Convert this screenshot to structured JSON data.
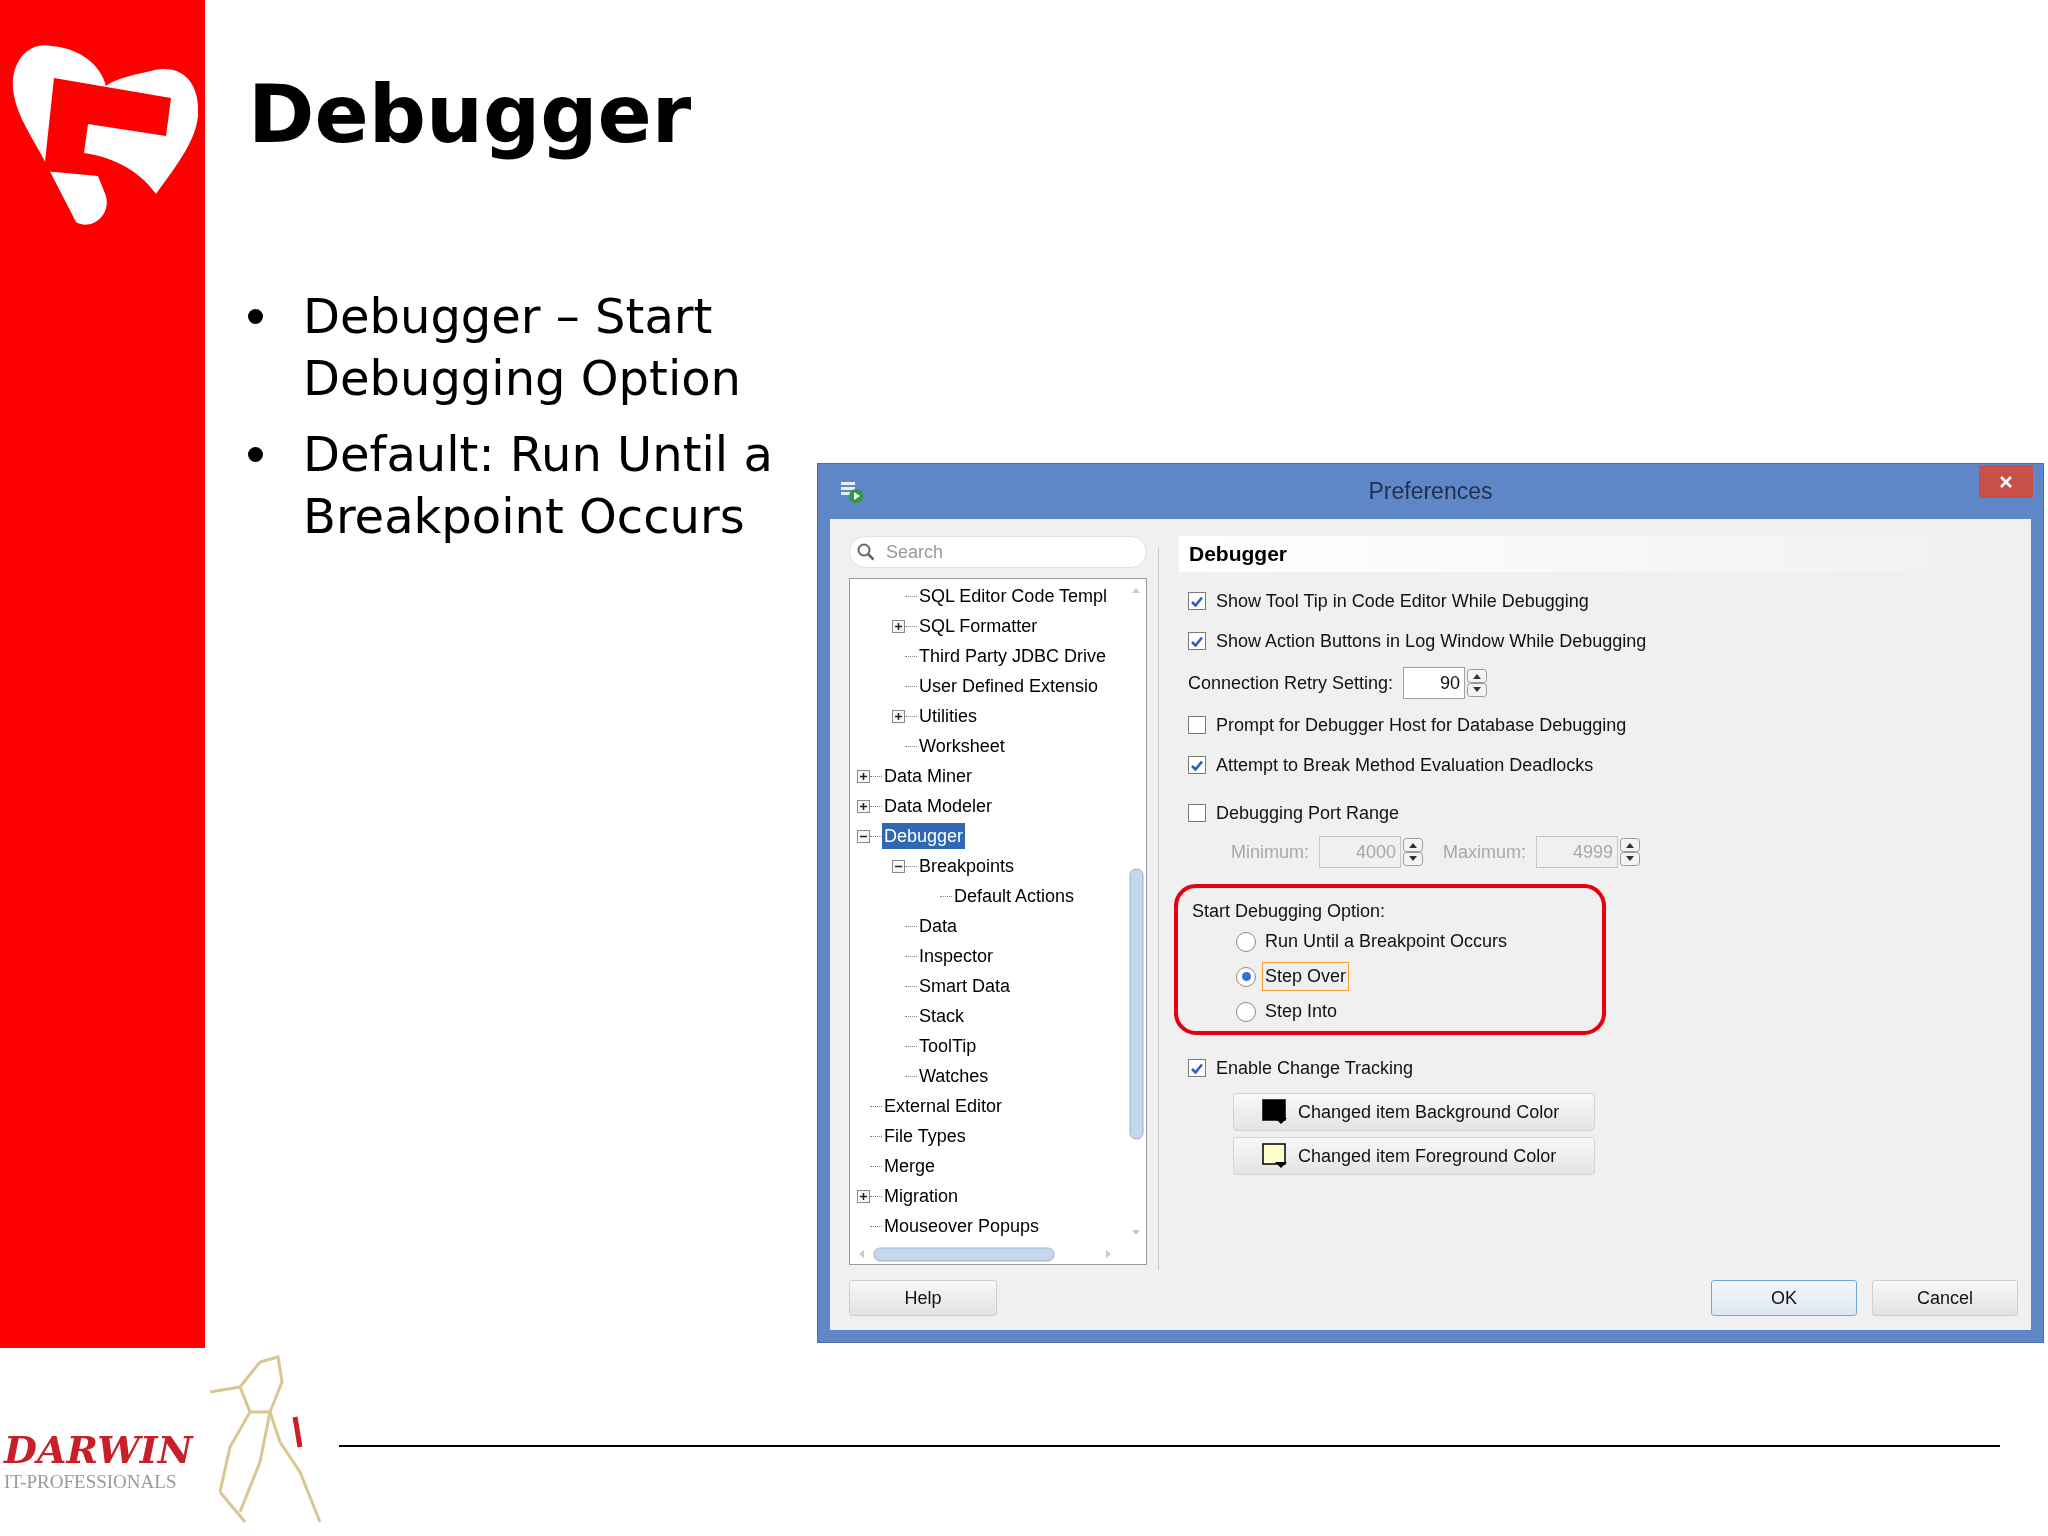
{
  "slide": {
    "title": "Debugger",
    "bullets": [
      "Debugger – Start Debugging Option",
      "Default: Run Until a Breakpoint Occurs"
    ],
    "footer_logo": {
      "name": "DARWIN",
      "tagline": "IT-PROFESSIONALS"
    }
  },
  "dialog": {
    "title": "Preferences",
    "search": {
      "placeholder": "Search"
    },
    "tree": {
      "continued_children": [
        {
          "label": "SQL Editor Code Templ",
          "selected": false
        },
        {
          "label": "SQL Formatter",
          "selected": false,
          "expanded": false
        },
        {
          "label": "Third Party JDBC Drive",
          "selected": false
        },
        {
          "label": "User Defined Extensio",
          "selected": false
        },
        {
          "label": "Utilities",
          "selected": false,
          "expanded": false
        },
        {
          "label": "Worksheet",
          "selected": false
        }
      ],
      "items": [
        {
          "label": "Data Miner",
          "selected": false,
          "expanded": false
        },
        {
          "label": "Data Modeler",
          "selected": false,
          "expanded": false
        },
        {
          "label": "Debugger",
          "selected": true,
          "expanded": true,
          "children": [
            {
              "label": "Breakpoints",
              "selected": false,
              "expanded": true,
              "children": [
                {
                  "label": "Default Actions",
                  "selected": false
                }
              ]
            },
            {
              "label": "Data",
              "selected": false
            },
            {
              "label": "Inspector",
              "selected": false
            },
            {
              "label": "Smart Data",
              "selected": false
            },
            {
              "label": "Stack",
              "selected": false
            },
            {
              "label": "ToolTip",
              "selected": false
            },
            {
              "label": "Watches",
              "selected": false
            }
          ]
        },
        {
          "label": "External Editor",
          "selected": false
        },
        {
          "label": "File Types",
          "selected": false
        },
        {
          "label": "Merge",
          "selected": false
        },
        {
          "label": "Migration",
          "selected": false,
          "expanded": false
        },
        {
          "label": "Mouseover Popups",
          "selected": false
        }
      ]
    },
    "panel_title": "Debugger",
    "options": [
      {
        "kind": "checkbox",
        "label": "Show Tool Tip in Code Editor While Debugging",
        "checked": true
      },
      {
        "kind": "checkbox",
        "label": "Show Action Buttons in Log Window While Debugging",
        "checked": true
      },
      {
        "kind": "spinner",
        "label": "Connection Retry Setting:",
        "value": "90"
      },
      {
        "kind": "checkbox",
        "label": "Prompt for Debugger Host for Database Debugging",
        "checked": false
      },
      {
        "kind": "checkbox",
        "label": "Attempt to Break Method Evaluation Deadlocks",
        "checked": true
      },
      {
        "kind": "checkbox",
        "label": "Debugging Port Range",
        "checked": false
      },
      {
        "kind": "range",
        "disabled": true,
        "min_label": "Minimum:",
        "min_value": "4000",
        "max_label": "Maximum:",
        "max_value": "4999"
      },
      {
        "kind": "radio_group",
        "label": "Start Debugging Option:",
        "highlighted": true,
        "options": [
          {
            "label": "Run Until a Breakpoint Occurs",
            "selected": false,
            "focused": false
          },
          {
            "label": "Step Over",
            "selected": true,
            "focused": true
          },
          {
            "label": "Step Into",
            "selected": false,
            "focused": false
          }
        ]
      },
      {
        "kind": "checkbox",
        "label": "Enable Change Tracking",
        "checked": true
      },
      {
        "kind": "color_button",
        "label": "Changed item Background Color",
        "color": "#000000"
      },
      {
        "kind": "color_button",
        "label": "Changed item Foreground Color",
        "color": "#ffffcc"
      }
    ],
    "buttons": {
      "help": "Help",
      "ok": "OK",
      "cancel": "Cancel"
    }
  }
}
